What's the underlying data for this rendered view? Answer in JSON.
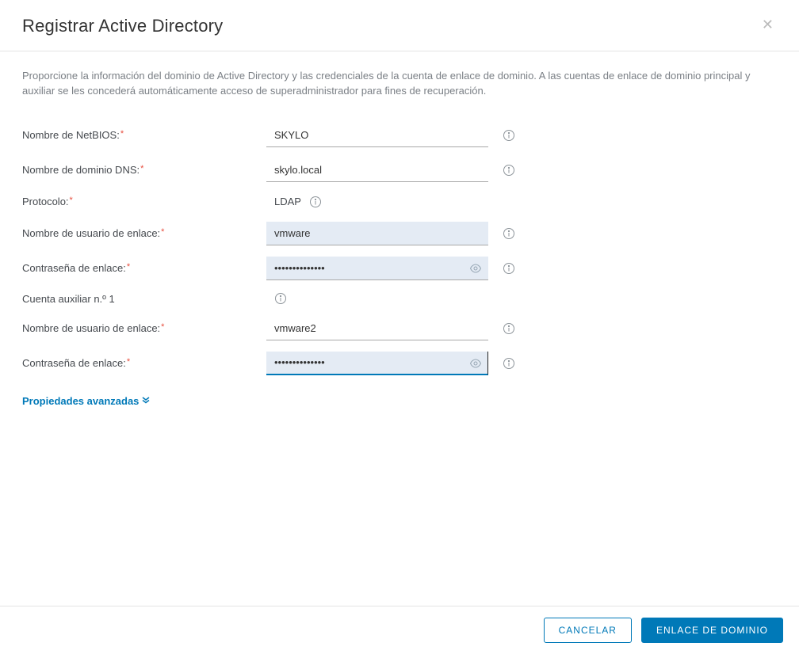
{
  "header": {
    "title": "Registrar Active Directory"
  },
  "description": "Proporcione la información del dominio de Active Directory y las credenciales de la cuenta de enlace de dominio. A las cuentas de enlace de dominio principal y auxiliar se les concederá automáticamente acceso de superadministrador para fines de recuperación.",
  "labels": {
    "netbios": "Nombre de NetBIOS:",
    "dns": "Nombre de dominio DNS:",
    "protocol": "Protocolo:",
    "bind_user": "Nombre de usuario de enlace:",
    "bind_pass": "Contraseña de enlace:",
    "aux_account": "Cuenta auxiliar n.º 1",
    "bind_user2": "Nombre de usuario de enlace:",
    "bind_pass2": "Contraseña de enlace:",
    "advanced": "Propiedades avanzadas"
  },
  "values": {
    "netbios": "SKYLO",
    "dns": "skylo.local",
    "protocol": "LDAP",
    "bind_user": "vmware",
    "bind_pass": "••••••••••••••",
    "bind_user2": "vmware2",
    "bind_pass2": "••••••••••••••"
  },
  "buttons": {
    "cancel": "CANCELAR",
    "submit": "ENLACE DE DOMINIO"
  }
}
